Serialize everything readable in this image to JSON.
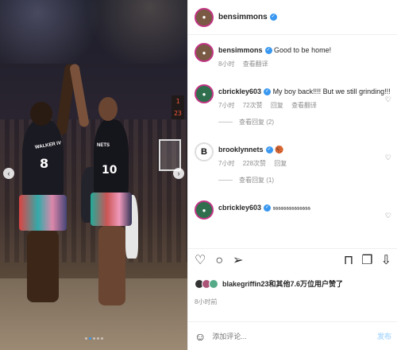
{
  "photo": {
    "jersey_left_name": "WALKER IV",
    "jersey_left_number": "8",
    "jersey_right_name": "NETS",
    "jersey_right_number": "10",
    "scoreboard": "1 23",
    "prev_icon": "chevron-left-icon",
    "next_icon": "chevron-right-icon"
  },
  "header": {
    "username": "bensimmons"
  },
  "caption": {
    "username": "bensimmons",
    "text": "Good to be home!",
    "time": "8小时",
    "translate": "查看翻译"
  },
  "comments": [
    {
      "username": "cbrickley603",
      "text": "My boy back!!!! But we still grinding!!!",
      "time": "7小时",
      "likes": "72次赞",
      "reply": "回复",
      "translate": "查看翻译",
      "replies": "查看回复 (2)"
    },
    {
      "username": "brooklynnets",
      "text": "🏀",
      "time": "7小时",
      "likes": "228次赞",
      "reply": "回复",
      "replies": "查看回复 (1)"
    },
    {
      "username": "cbrickley603",
      "text": "𝔰𝔰𝔰𝔰𝔰𝔰𝔰𝔰𝔰𝔰𝔰𝔰𝔰𝔰"
    }
  ],
  "likes": {
    "text_user": "blakegriffin23",
    "text_rest": "和其他7.6万位用户赞了"
  },
  "timestamp": "8小时前",
  "add_comment": {
    "placeholder": "添加评论...",
    "post": "发布"
  },
  "colors": {
    "verified": "#3897f0",
    "muted": "#8e8e8e",
    "post_disabled": "#b3dbff"
  }
}
